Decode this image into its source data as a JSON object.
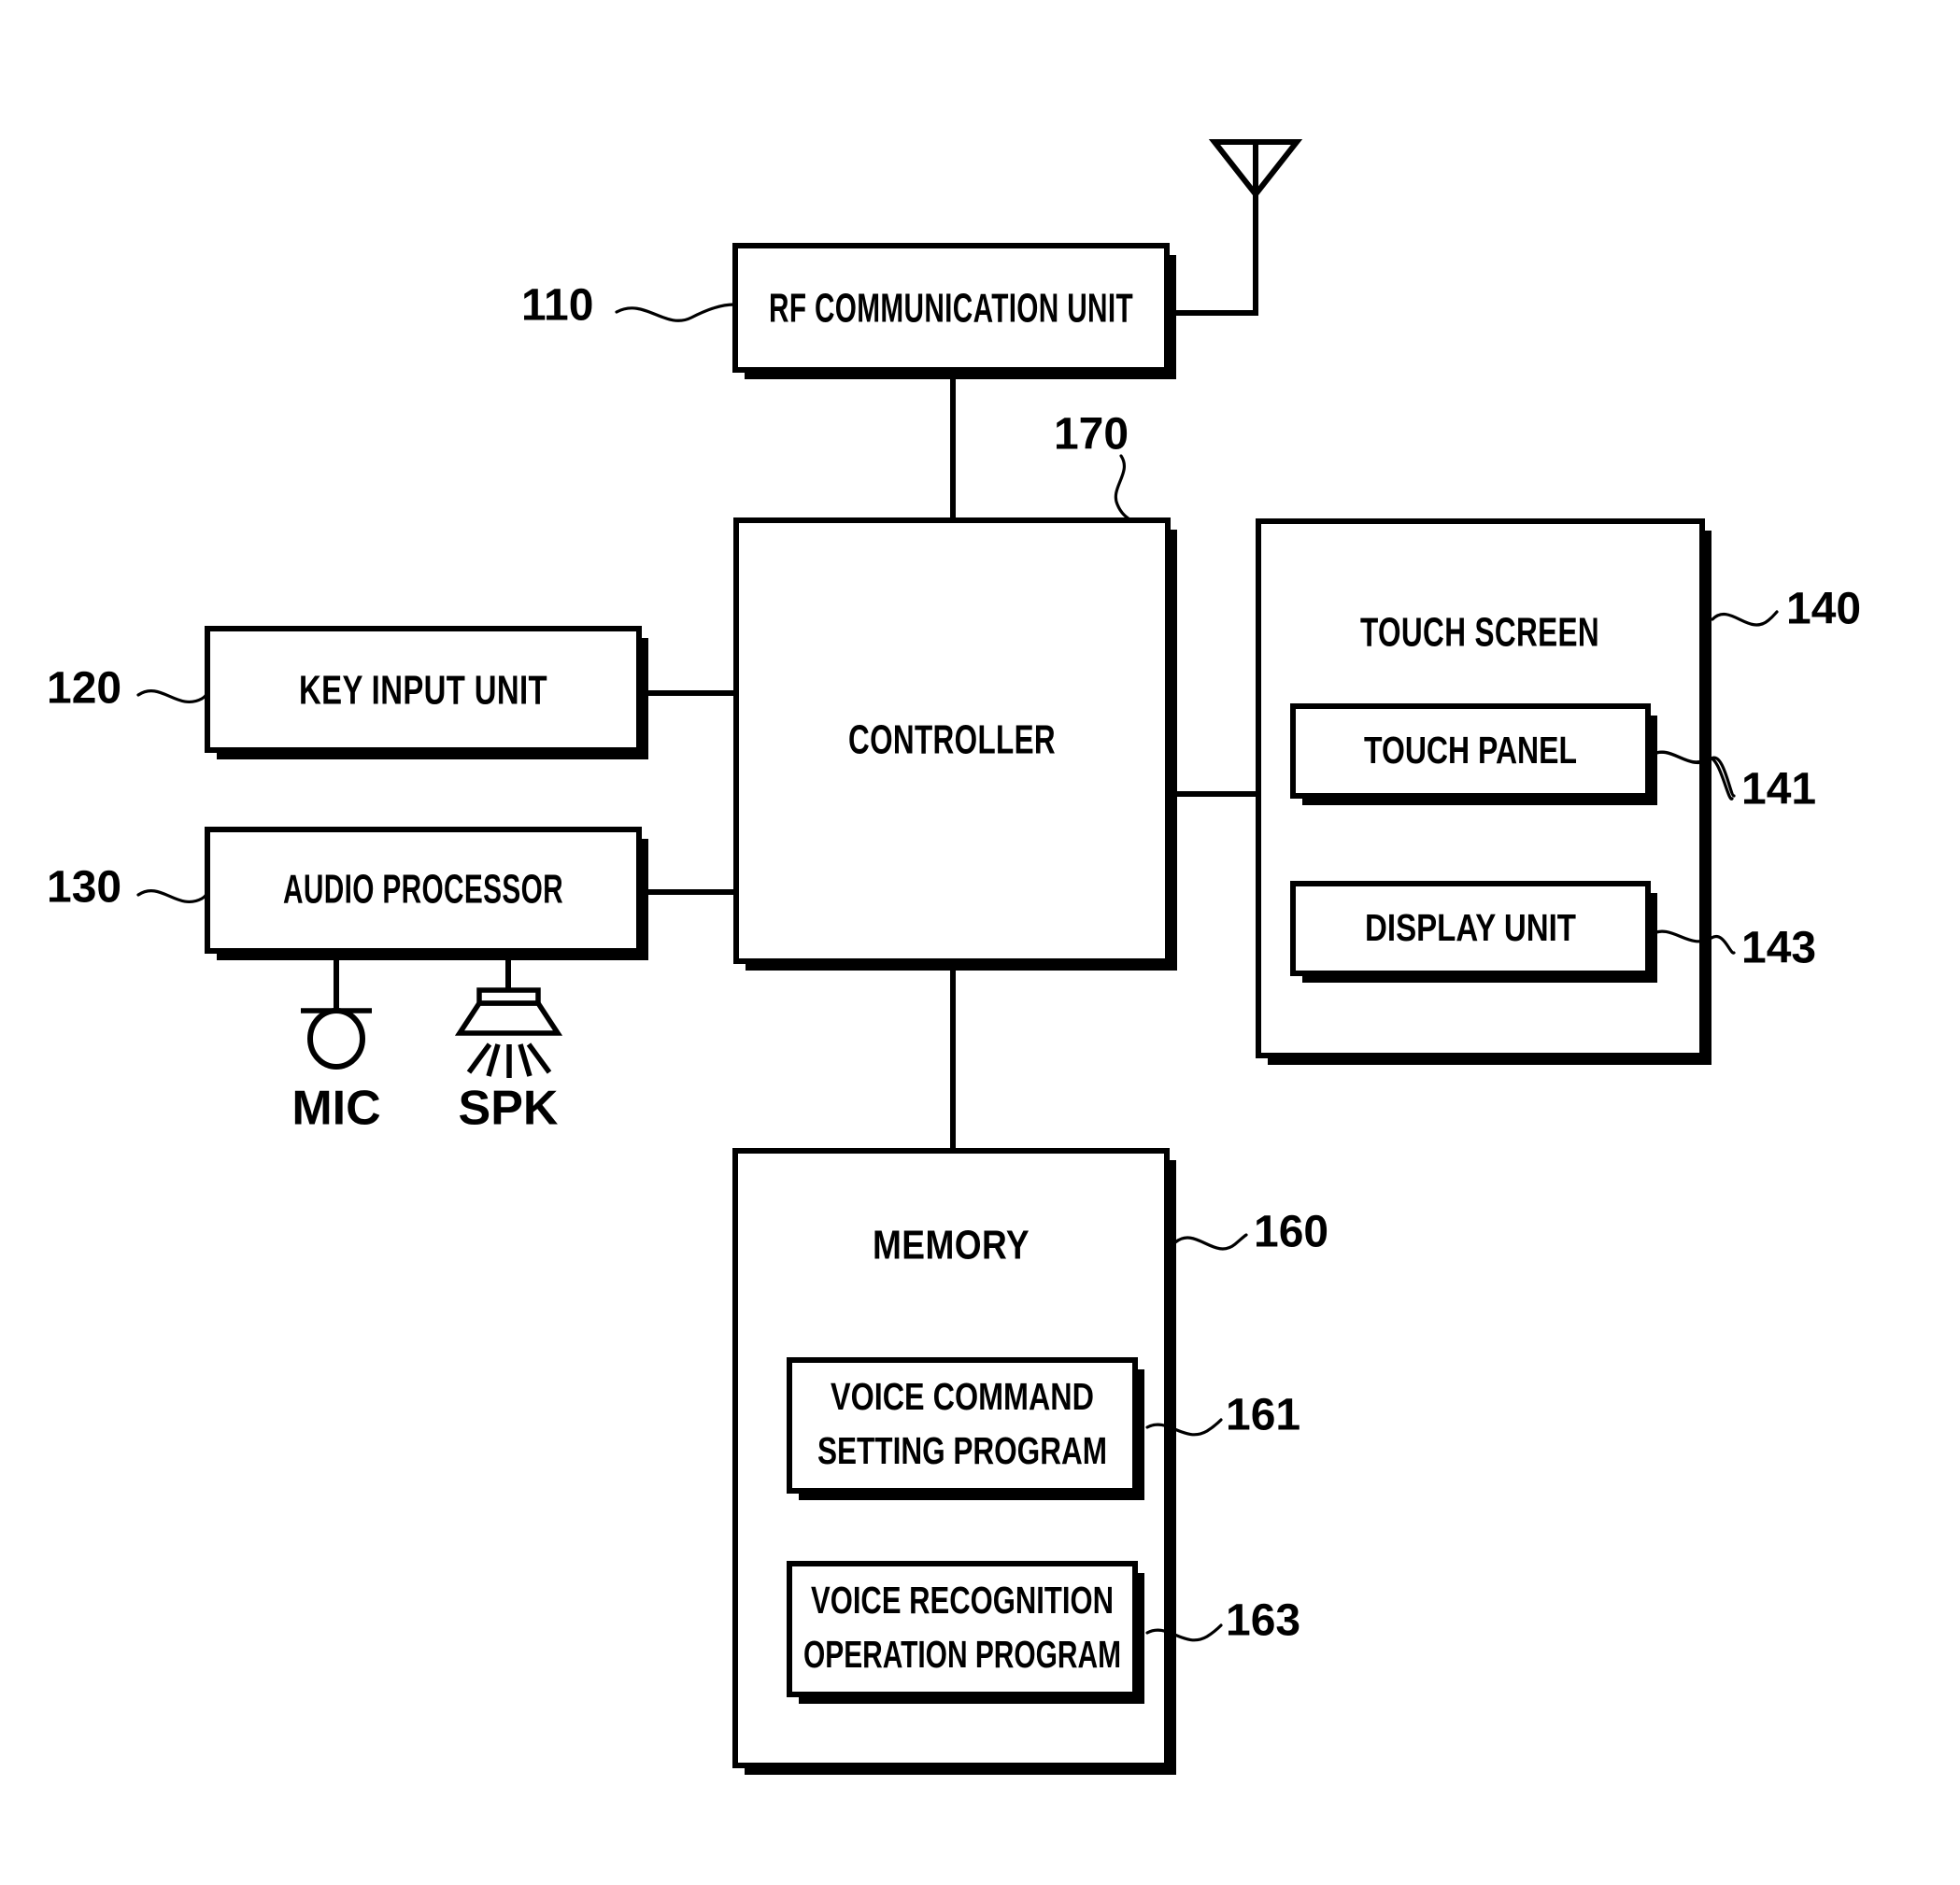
{
  "figure": {
    "type": "patent-block-diagram",
    "title": "Mobile terminal block diagram"
  },
  "blocks": {
    "rf_communication_unit": {
      "label": "RF COMMUNICATION UNIT",
      "ref": "110"
    },
    "key_input_unit": {
      "label": "KEY INPUT UNIT",
      "ref": "120"
    },
    "audio_processor": {
      "label": "AUDIO PROCESSOR",
      "ref": "130"
    },
    "controller": {
      "label": "CONTROLLER",
      "ref": "170"
    },
    "touch_screen": {
      "label": "TOUCH SCREEN",
      "ref": "140"
    },
    "touch_panel": {
      "label": "TOUCH PANEL",
      "ref": "141"
    },
    "display_unit": {
      "label": "DISPLAY UNIT",
      "ref": "143"
    },
    "memory": {
      "label": "MEMORY",
      "ref": "160"
    },
    "voice_command_setting_program": {
      "label_line1": "VOICE COMMAND",
      "label_line2": "SETTING PROGRAM",
      "ref": "161"
    },
    "voice_recognition_operation_program": {
      "label_line1": "VOICE RECOGNITION",
      "label_line2": "OPERATION PROGRAM",
      "ref": "163"
    }
  },
  "peripherals": {
    "mic": {
      "label": "MIC",
      "icon": "microphone-icon"
    },
    "spk": {
      "label": "SPK",
      "icon": "speaker-icon"
    },
    "antenna": {
      "icon": "antenna-icon"
    }
  },
  "colors": {
    "line": "#000000",
    "fill": "#ffffff",
    "shadow": "#000000"
  }
}
